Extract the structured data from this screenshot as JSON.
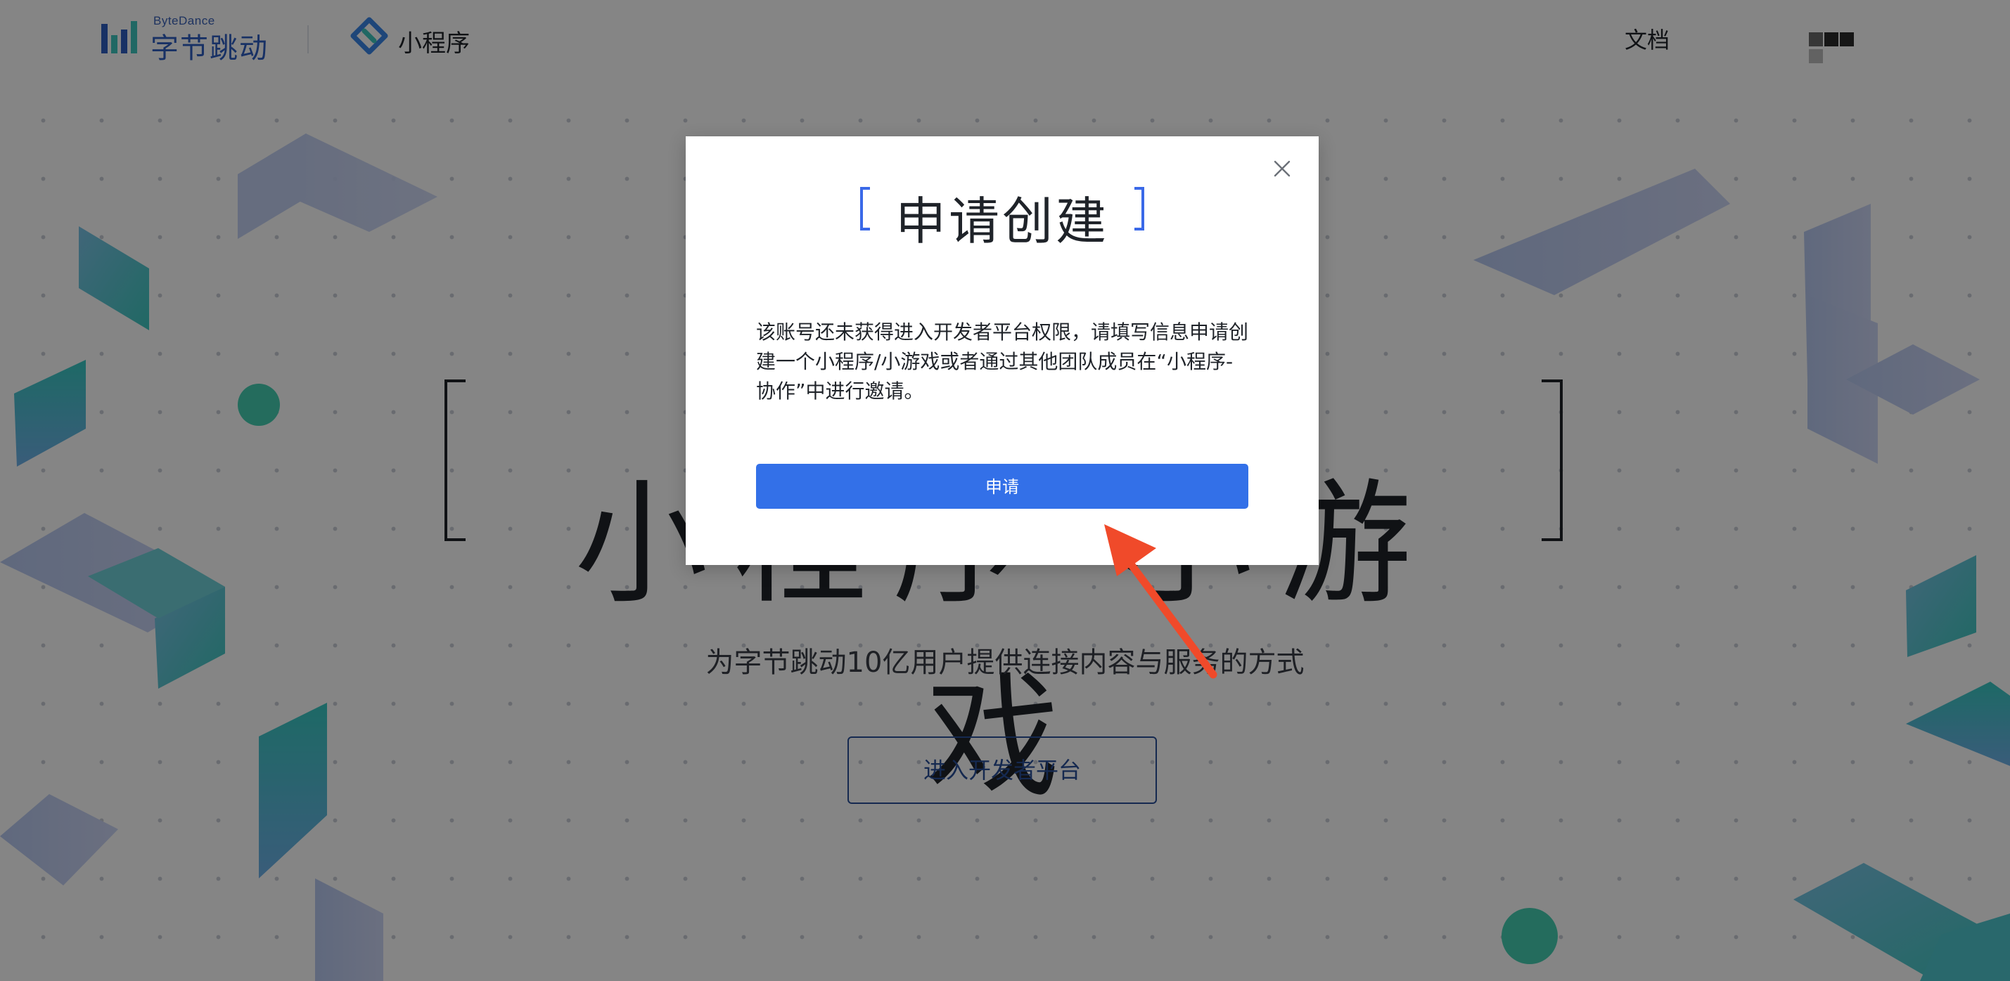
{
  "header": {
    "brand_small": "ByteDance",
    "brand_name": "字节跳动",
    "product_name": "小程序",
    "nav_docs": "文档",
    "user_badge_colors": [
      "#6a6a6a",
      "#2b2b2b",
      "#2b2b2b",
      "#bdbdbd"
    ]
  },
  "hero": {
    "title": "小程序·小游戏",
    "subtitle": "为字节跳动10亿用户提供连接内容与服务的方式",
    "cta_label": "进入开发者平台"
  },
  "modal": {
    "title": "申请创建",
    "description": "该账号还未获得进入开发者平台权限，请填写信息申请创建一个小程序/小游戏或者通过其他团队成员在“小程序-协作”中进行邀请。",
    "apply_label": "申请",
    "close_icon": "close-icon"
  },
  "annotation": {
    "arrow_color": "#f04a2a"
  },
  "colors": {
    "primary": "#3370e8",
    "overlay": "rgba(0,0,0,0.48)",
    "brand_blue": "#2f5fc2"
  }
}
